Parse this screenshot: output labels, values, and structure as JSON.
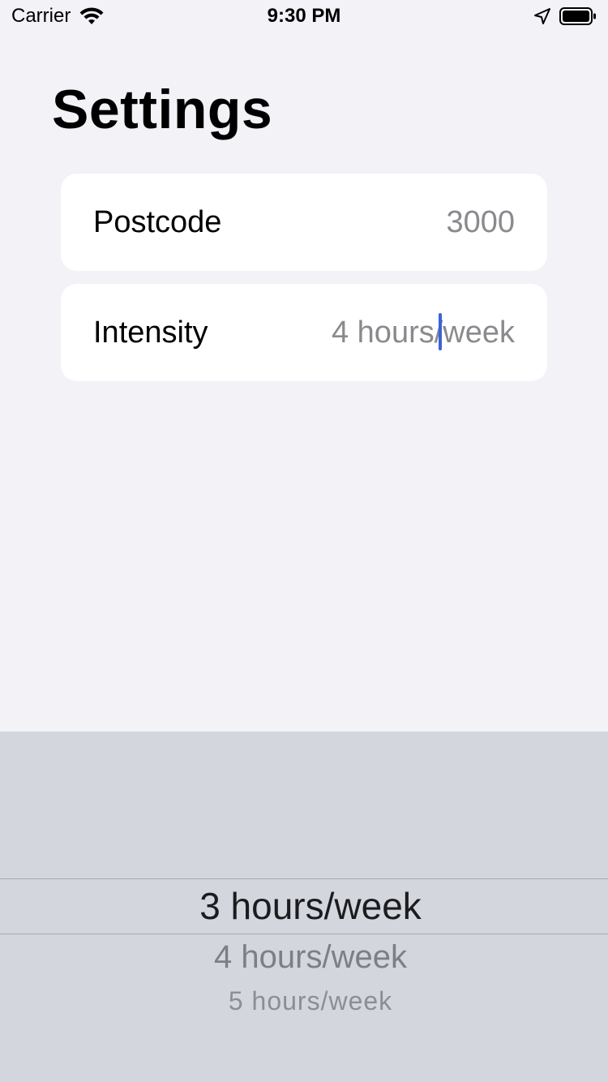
{
  "status_bar": {
    "carrier": "Carrier",
    "time": "9:30 PM",
    "icons": [
      "wifi-icon",
      "location-arrow-icon",
      "battery-icon"
    ]
  },
  "page": {
    "title": "Settings"
  },
  "rows": [
    {
      "label": "Postcode",
      "value": "3000"
    },
    {
      "label": "Intensity",
      "value": "4 hours/week"
    }
  ],
  "picker": {
    "options_visible": [
      "3 hours/week",
      "4 hours/week",
      "5 hours/week"
    ],
    "selected": "3 hours/week"
  },
  "colors": {
    "background": "#f2f2f7",
    "card": "#ffffff",
    "value_text": "#8a8a8e",
    "caret": "#3b63d8",
    "picker_background": "#d3d6dd"
  }
}
